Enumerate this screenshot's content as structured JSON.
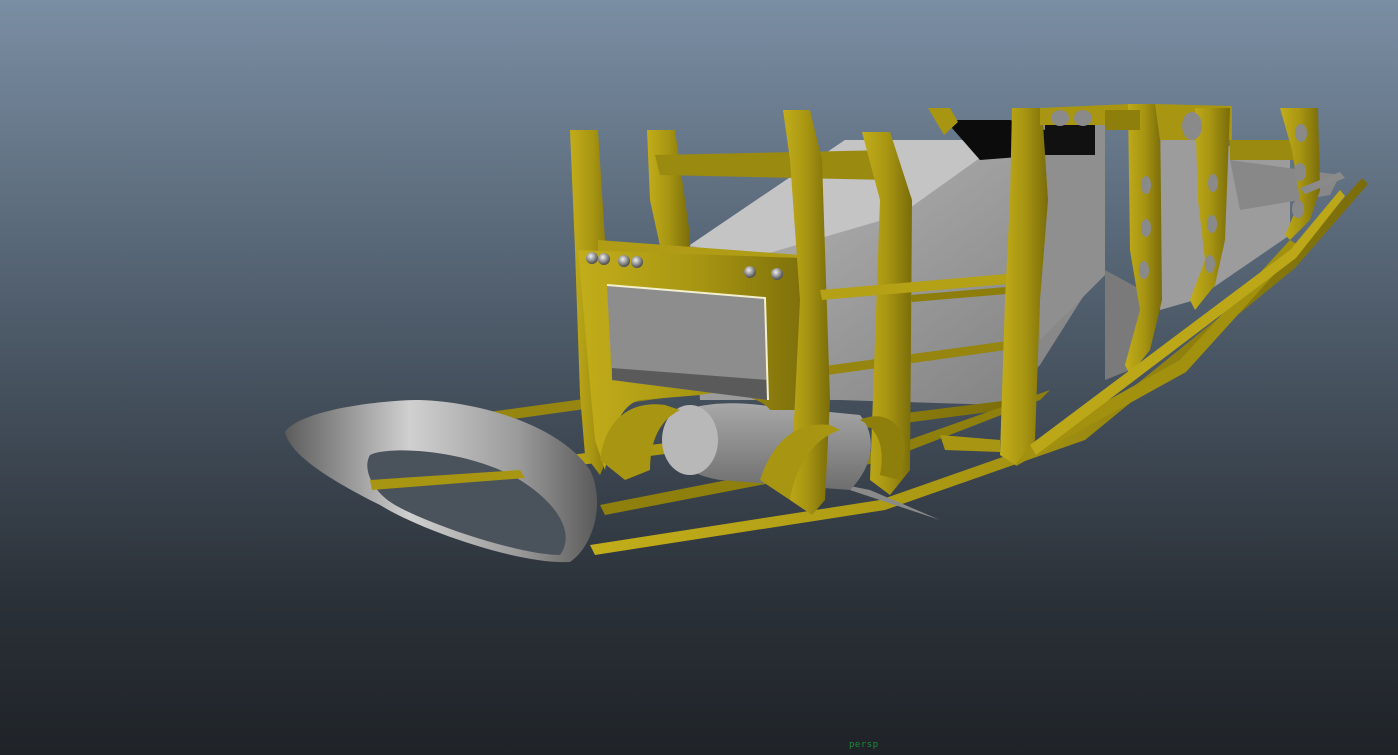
{
  "viewport": {
    "camera_label": "persp",
    "colors": {
      "background_top": "#7a8ea3",
      "background_bottom": "#1f2328",
      "frame": "#a89612",
      "frame_dark": "#7a6c0a",
      "panel": "#9a9a9a",
      "camera_label": "#1f8a3a"
    }
  }
}
